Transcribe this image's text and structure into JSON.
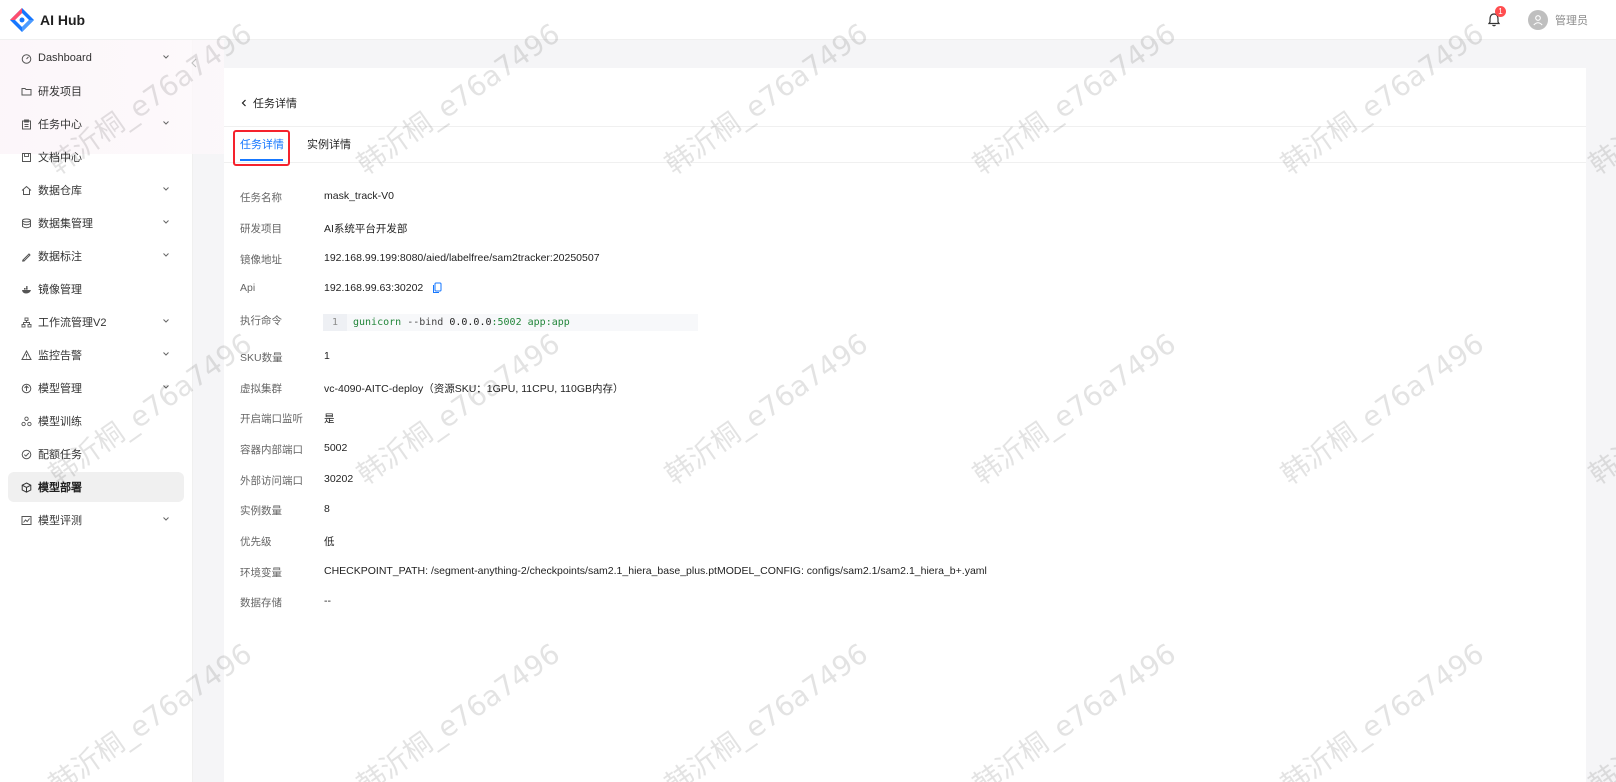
{
  "app": {
    "name": "AI Hub",
    "notification_count": "1",
    "username": "管理员"
  },
  "sidebar": {
    "items": [
      {
        "label": "Dashboard",
        "icon": "dashboard-icon",
        "expandable": true
      },
      {
        "label": "研发项目",
        "icon": "folder-icon",
        "expandable": false
      },
      {
        "label": "任务中心",
        "icon": "clipboard-icon",
        "expandable": true
      },
      {
        "label": "文档中心",
        "icon": "save-icon",
        "expandable": false
      },
      {
        "label": "数据仓库",
        "icon": "home-icon",
        "expandable": true
      },
      {
        "label": "数据集管理",
        "icon": "database-icon",
        "expandable": true
      },
      {
        "label": "数据标注",
        "icon": "highlight-icon",
        "expandable": true
      },
      {
        "label": "镜像管理",
        "icon": "docker-icon",
        "expandable": false
      },
      {
        "label": "工作流管理V2",
        "icon": "workflow-icon",
        "expandable": true
      },
      {
        "label": "监控告警",
        "icon": "warning-icon",
        "expandable": true
      },
      {
        "label": "模型管理",
        "icon": "model-icon",
        "expandable": true
      },
      {
        "label": "模型训练",
        "icon": "cluster-icon",
        "expandable": false
      },
      {
        "label": "配额任务",
        "icon": "check-circle-icon",
        "expandable": false
      },
      {
        "label": "模型部署",
        "icon": "cube-icon",
        "expandable": false,
        "active": true
      },
      {
        "label": "模型评测",
        "icon": "chart-icon",
        "expandable": true
      }
    ]
  },
  "page": {
    "back_label": "任务详情",
    "tabs": [
      {
        "label": "任务详情",
        "active": true
      },
      {
        "label": "实例详情",
        "active": false
      }
    ],
    "details": [
      {
        "label": "任务名称",
        "value": "mask_track-V0"
      },
      {
        "label": "研发项目",
        "value": "AI系统平台开发部"
      },
      {
        "label": "镜像地址",
        "value": "192.168.99.199:8080/aied/labelfree/sam2tracker:20250507"
      },
      {
        "label": "Api",
        "value": "192.168.99.63:30202"
      },
      {
        "label": "执行命令",
        "value": ""
      },
      {
        "label": "SKU数量",
        "value": "1"
      },
      {
        "label": "虚拟集群",
        "value": "vc-4090-AITC-deploy（资源SKU：1GPU, 11CPU, 110GB内存）"
      },
      {
        "label": "开启端口监听",
        "value": "是"
      },
      {
        "label": "容器内部端口",
        "value": "5002"
      },
      {
        "label": "外部访问端口",
        "value": "30202"
      },
      {
        "label": "实例数量",
        "value": "8"
      },
      {
        "label": "优先级",
        "value": "低"
      },
      {
        "label": "环境变量",
        "value": "CHECKPOINT_PATH: /segment-anything-2/checkpoints/sam2.1_hiera_base_plus.ptMODEL_CONFIG: configs/sam2.1/sam2.1_hiera_b+.yaml"
      },
      {
        "label": "数据存储",
        "value": "--"
      }
    ],
    "command": {
      "line_number": "1",
      "tokens": [
        "gunicorn",
        " --bind ",
        "0.0.0.0",
        ":5002",
        " app:app"
      ]
    }
  },
  "watermark": "韩沂桐_e76a7496",
  "colors": {
    "accent": "#1677ff",
    "highlight_border": "#f5222d",
    "badge": "#ff4d4f"
  }
}
